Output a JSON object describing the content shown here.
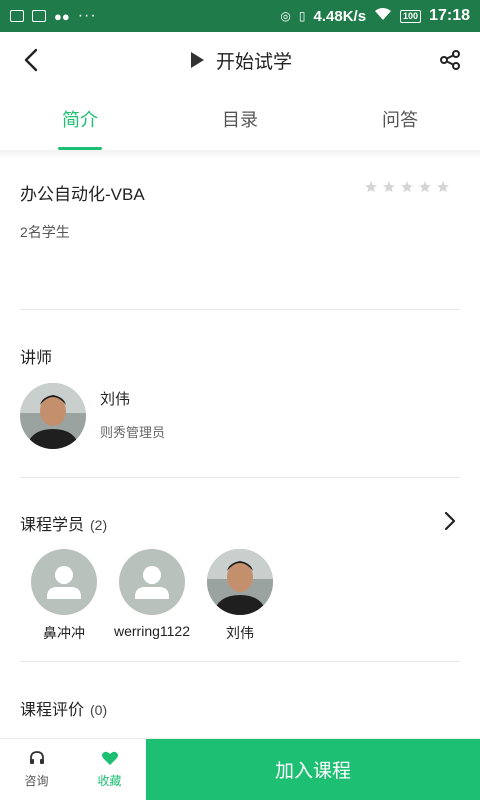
{
  "status_bar": {
    "dots": "···",
    "speed": "4.48K/s",
    "battery": "100",
    "time": "17:18"
  },
  "nav": {
    "title": "开始试学"
  },
  "tabs": [
    {
      "label": "简介",
      "active": true
    },
    {
      "label": "目录",
      "active": false
    },
    {
      "label": "问答",
      "active": false
    }
  ],
  "course": {
    "title": "办公自动化-VBA",
    "rating": 0,
    "rating_max": 5,
    "students": "2名学生"
  },
  "teacher_section": {
    "title": "讲师",
    "name": "刘伟",
    "role": "则秀管理员"
  },
  "members_section": {
    "title": "课程学员",
    "count": "(2)",
    "members": [
      {
        "name": "鼻冲冲",
        "avatar": "default-avatar-icon"
      },
      {
        "name": "werring1122",
        "avatar": "default-avatar-icon"
      },
      {
        "name": "刘伟",
        "avatar": "photo"
      }
    ]
  },
  "reviews_section": {
    "title": "课程评价",
    "count": "(0)"
  },
  "bottom_bar": {
    "consult_label": "咨询",
    "favorite_label": "收藏",
    "join_label": "加入课程"
  },
  "colors": {
    "accent": "#1dbf73",
    "status_bar": "#1f7b4a",
    "star_empty": "#d6d6d6"
  }
}
